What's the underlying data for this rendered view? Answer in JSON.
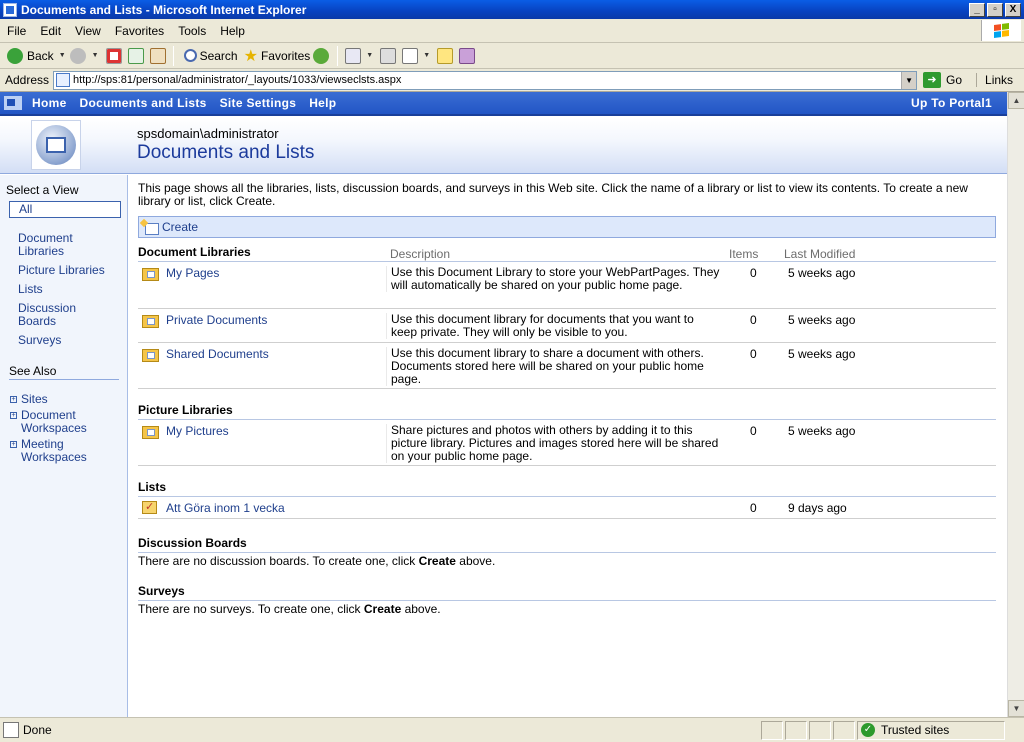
{
  "window": {
    "title": "Documents and Lists - Microsoft Internet Explorer",
    "btn_min": "_",
    "btn_max": "▫",
    "btn_close": "X"
  },
  "menu": [
    "File",
    "Edit",
    "View",
    "Favorites",
    "Tools",
    "Help"
  ],
  "toolbar": {
    "back": "Back",
    "search": "Search",
    "favorites": "Favorites"
  },
  "address": {
    "label": "Address",
    "url": "http://sps:81/personal/administrator/_layouts/1033/viewseclsts.aspx",
    "go": "Go",
    "links": "Links"
  },
  "topnav": {
    "items": [
      "Home",
      "Documents and Lists",
      "Site Settings",
      "Help"
    ],
    "portal": "Up To Portal1"
  },
  "header": {
    "user": "spsdomain\\administrator",
    "title": "Documents and Lists"
  },
  "leftnav": {
    "select_view": "Select a View",
    "views": [
      "All",
      "Document Libraries",
      "Picture Libraries",
      "Lists",
      "Discussion Boards",
      "Surveys"
    ],
    "see_also": "See Also",
    "see_also_items": [
      "Sites",
      "Document Workspaces",
      "Meeting Workspaces"
    ]
  },
  "main": {
    "intro": "This page shows all the libraries, lists, discussion boards, and surveys in this Web site. Click the name of a library or list to view its contents. To create a new library or list, click Create.",
    "create": "Create",
    "columns": {
      "description": "Description",
      "items": "Items",
      "modified": "Last Modified"
    },
    "doclibs": {
      "title": "Document Libraries",
      "rows": [
        {
          "name": "My Pages",
          "desc": "Use this Document Library to store your WebPartPages. They will automatically be shared on your public home page.",
          "items": "0",
          "modified": "5 weeks ago"
        },
        {
          "name": "Private Documents",
          "desc": "Use this document library for documents that you want to keep private.  They will only be visible to you.",
          "items": "0",
          "modified": "5 weeks ago"
        },
        {
          "name": "Shared Documents",
          "desc": "Use this document library to share a document with others. Documents stored here will be shared on your public home page.",
          "items": "0",
          "modified": "5 weeks ago"
        }
      ]
    },
    "piclibs": {
      "title": "Picture Libraries",
      "rows": [
        {
          "name": "My Pictures",
          "desc": "Share pictures and photos with others by adding it to this picture library. Pictures and images stored here will be shared on your public home page.",
          "items": "0",
          "modified": "5 weeks ago"
        }
      ]
    },
    "lists": {
      "title": "Lists",
      "rows": [
        {
          "name": "Att Göra inom 1 vecka",
          "desc": "",
          "items": "0",
          "modified": "9 days ago"
        }
      ]
    },
    "discussions": {
      "title": "Discussion Boards",
      "text_pre": "There are no discussion boards. To create one, click ",
      "text_bold": "Create",
      "text_post": " above."
    },
    "surveys": {
      "title": "Surveys",
      "text_pre": "There are no surveys. To create one, click ",
      "text_bold": "Create",
      "text_post": " above."
    }
  },
  "status": {
    "text": "Done",
    "zone": "Trusted sites"
  }
}
